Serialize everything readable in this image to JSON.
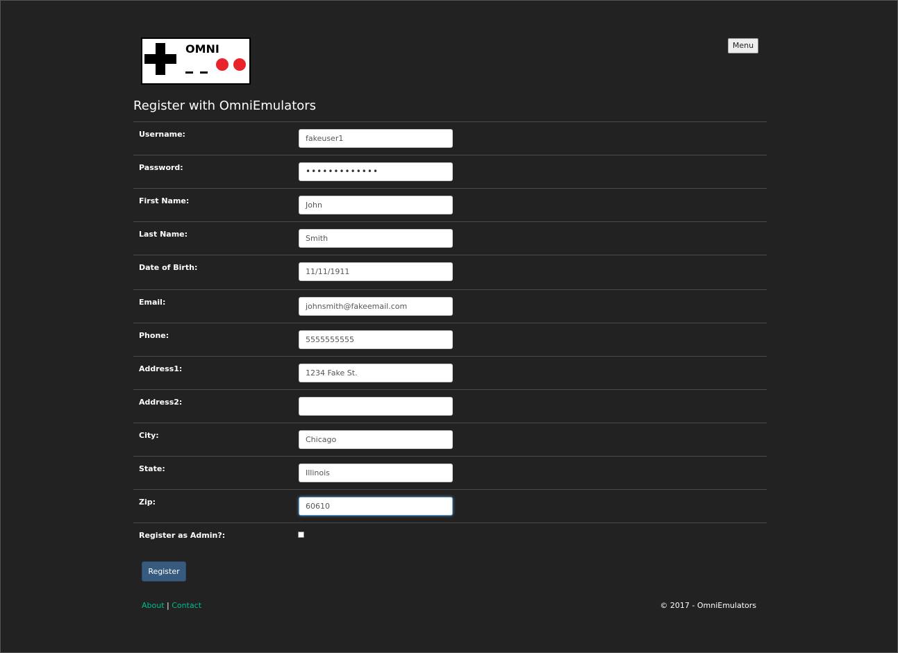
{
  "header": {
    "logo_text": "OMNI",
    "menu_label": "Menu"
  },
  "page_title": "Register with OmniEmulators",
  "form": {
    "fields": [
      {
        "label": "Username:",
        "value": "fakeuser1"
      },
      {
        "label": "Password:",
        "value": "•••••••••••••"
      },
      {
        "label": "First Name:",
        "value": "John"
      },
      {
        "label": "Last Name:",
        "value": "Smith"
      },
      {
        "label": "Date of Birth:",
        "value": "11/11/1911"
      },
      {
        "label": "Email:",
        "value": "johnsmith@fakeemail.com"
      },
      {
        "label": "Phone:",
        "value": "5555555555"
      },
      {
        "label": "Address1:",
        "value": "1234 Fake St."
      },
      {
        "label": "Address2:",
        "value": ""
      },
      {
        "label": "City:",
        "value": "Chicago"
      },
      {
        "label": "State:",
        "value": "Illinois"
      },
      {
        "label": "Zip:",
        "value": "60610"
      }
    ],
    "admin_label": "Register as Admin?:",
    "admin_checked": false,
    "submit_label": "Register"
  },
  "footer": {
    "about_label": "About",
    "separator": "|",
    "contact_label": "Contact",
    "copyright": "© 2017 - OmniEmulators"
  },
  "colors": {
    "background": "#222222",
    "link": "#00bc8c",
    "button": "#375a7f",
    "logo_dot": "#e8232a"
  }
}
